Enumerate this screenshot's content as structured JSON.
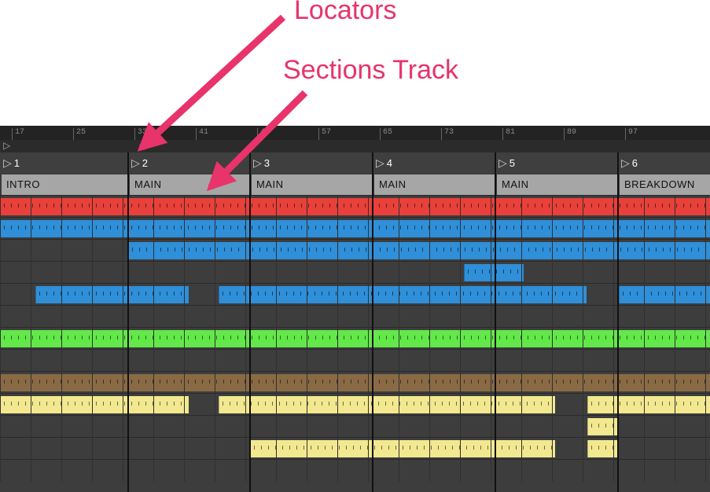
{
  "annotations": {
    "locators": "Locators",
    "sections_track": "Sections Track"
  },
  "ruler": {
    "labels": [
      "17",
      "25",
      "33",
      "41",
      "49",
      "57",
      "65",
      "73",
      "81",
      "89",
      "97"
    ]
  },
  "locators": [
    {
      "label": "1"
    },
    {
      "label": "2"
    },
    {
      "label": "3"
    },
    {
      "label": "4"
    },
    {
      "label": "5"
    },
    {
      "label": "6"
    }
  ],
  "sections": [
    {
      "label": "INTRO"
    },
    {
      "label": "MAIN"
    },
    {
      "label": "MAIN"
    },
    {
      "label": "MAIN"
    },
    {
      "label": "MAIN"
    },
    {
      "label": "BREAKDOWN"
    }
  ],
  "colors": {
    "red": "#e8403a",
    "blue": "#2f8fd8",
    "green": "#63e84a",
    "brown": "#8a6a45",
    "yellow": "#f2e890",
    "annotation": "#e8336b"
  },
  "track_colors": [
    "red",
    "blue",
    "blue",
    "blue",
    "blue",
    "empty",
    "green",
    "empty",
    "brown",
    "yellow",
    "yellow",
    "yellow",
    "empty"
  ]
}
